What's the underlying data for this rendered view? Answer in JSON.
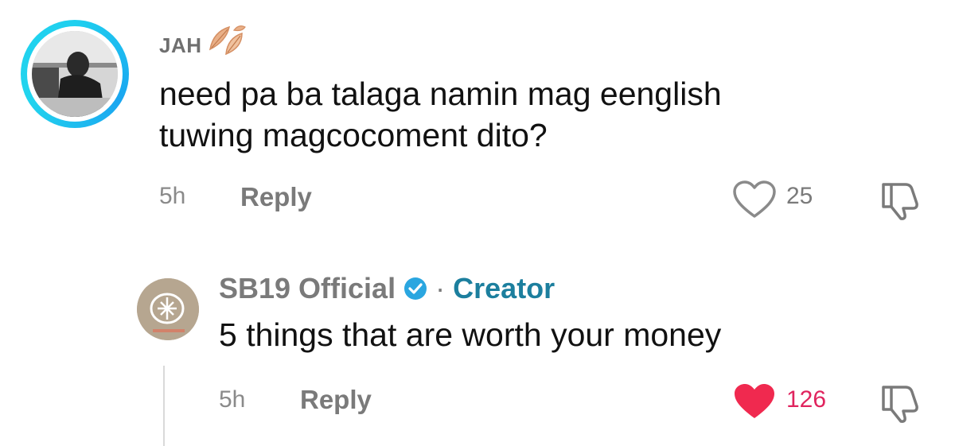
{
  "comments": [
    {
      "username": "JAH",
      "text_line1": "need pa ba talaga namin mag eenglish",
      "text_line2": "tuwing magcocoment dito?",
      "time": "5h",
      "reply_label": "Reply",
      "likes": "25",
      "liked": false,
      "icons": {
        "like": "heart-outline-icon",
        "dislike": "thumbs-down-icon",
        "badge": "leaf-icon"
      }
    },
    {
      "username": "SB19 Official",
      "verified": true,
      "separator": "·",
      "role": "Creator",
      "text": "5 things that are worth your money",
      "time": "5h",
      "reply_label": "Reply",
      "likes": "126",
      "liked": true,
      "icons": {
        "like": "heart-filled-icon",
        "dislike": "thumbs-down-icon",
        "badge": "verified-check-icon"
      }
    }
  ],
  "colors": {
    "ring": "#1fd0ef",
    "liked_heart": "#f0294f",
    "like_count_active": "#e0245e",
    "creator": "#1c7f9e",
    "verified": "#2aa6e0"
  }
}
